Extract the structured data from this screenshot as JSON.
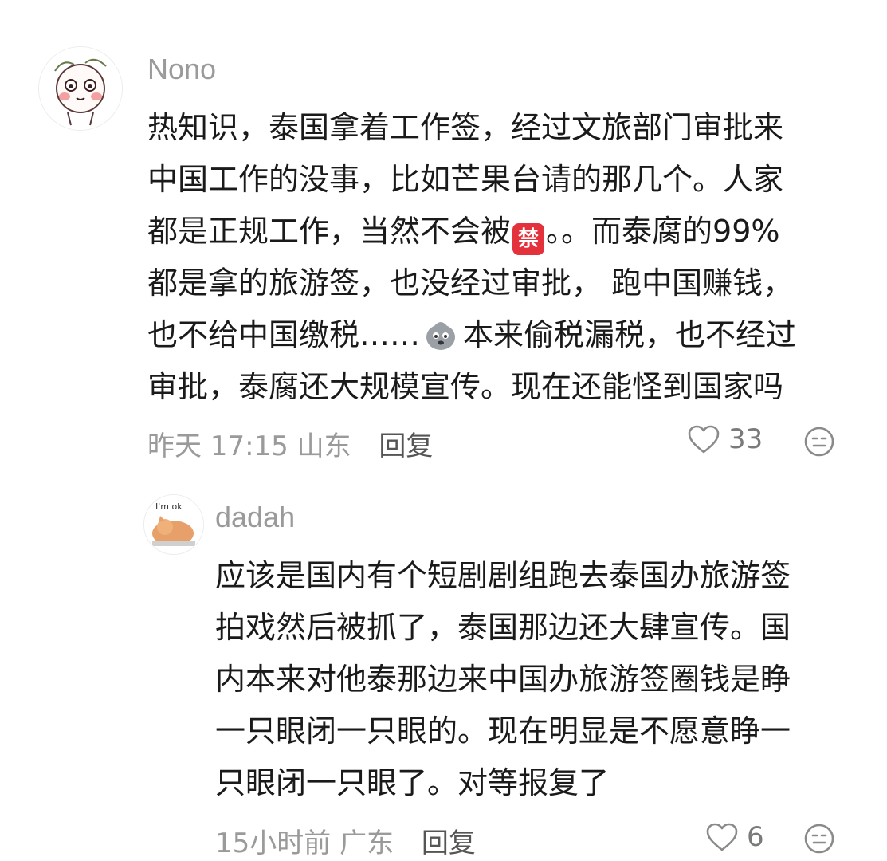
{
  "comments": [
    {
      "username": "Nono",
      "lines": [
        "热知识，泰国拿着工作签，经过文旅部门审批来",
        "中国工作的没事，比如芒果台请的那几个。人家",
        "都是正规工作，当然不会被",
        "都是拿的旅游签，也没经过审批， 跑中国赚钱，",
        "也不给中国缴税……",
        "审批，泰腐还大规模宣传。现在还能怪到国家吗"
      ],
      "line3_tail": "。。而泰腐的99%",
      "line5_tail": "本来偷税漏税，也不经过",
      "ban_emoji": "禁",
      "ghost_emoji_name": "sweat-emoji",
      "time": "昨天 17:15",
      "location": "山东",
      "reply_label": "回复",
      "likes": "33"
    },
    {
      "username": "dadah",
      "avatar_text": "I'm ok",
      "lines": [
        "应该是国内有个短剧剧组跑去泰国办旅游签",
        "拍戏然后被抓了，泰国那边还大肆宣传。国",
        "内本来对他泰那边来中国办旅游签圈钱是睁",
        "一只眼闭一只眼的。现在明显是不愿意睁一",
        "只眼闭一只眼了。对等报复了"
      ],
      "time": "15小时前",
      "location": "广东",
      "reply_label": "回复",
      "likes": "6"
    }
  ],
  "colors": {
    "ban_badge": "#e3323b",
    "muted": "#9a9a9a",
    "text": "#1a1a1a"
  }
}
